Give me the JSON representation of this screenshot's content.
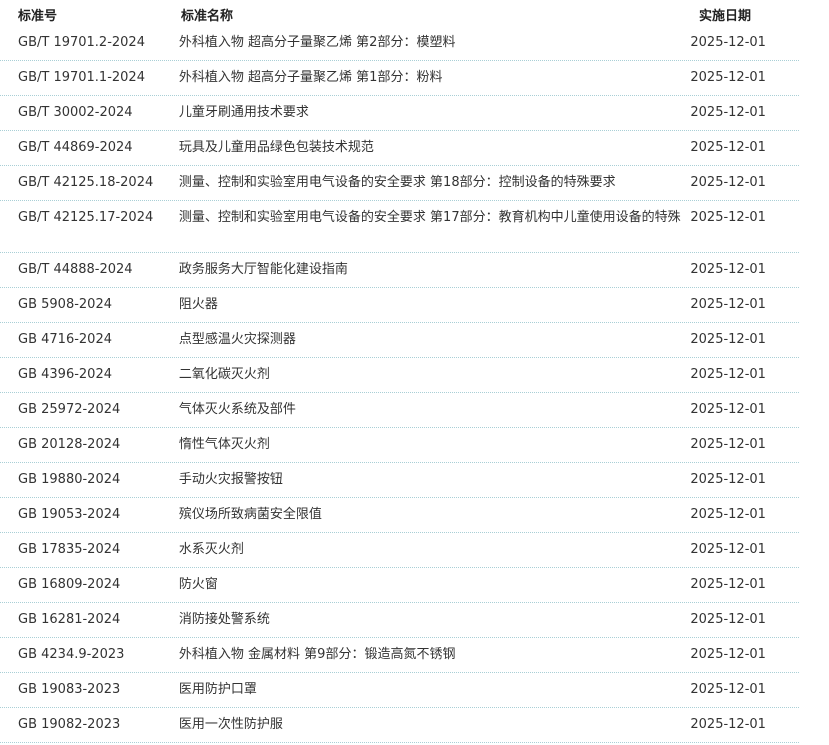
{
  "table": {
    "headers": {
      "code": "标准号",
      "name": "标准名称",
      "date": "实施日期"
    },
    "rows": [
      {
        "code": "GB/T 19701.2-2024",
        "name": "外科植入物 超高分子量聚乙烯 第2部分：模塑料",
        "date": "2025-12-01"
      },
      {
        "code": "GB/T 19701.1-2024",
        "name": "外科植入物 超高分子量聚乙烯 第1部分：粉料",
        "date": "2025-12-01"
      },
      {
        "code": "GB/T 30002-2024",
        "name": "儿童牙刷通用技术要求",
        "date": "2025-12-01"
      },
      {
        "code": "GB/T 44869-2024",
        "name": "玩具及儿童用品绿色包装技术规范",
        "date": "2025-12-01"
      },
      {
        "code": "GB/T 42125.18-2024",
        "name": "测量、控制和实验室用电气设备的安全要求 第18部分：控制设备的特殊要求",
        "date": "2025-12-01"
      },
      {
        "code": "GB/T 42125.17-2024",
        "name": "测量、控制和实验室用电气设备的安全要求 第17部分：教育机构中儿童使用设备的特殊",
        "date": "2025-12-01"
      },
      {
        "code": "GB/T 44888-2024",
        "name": "政务服务大厅智能化建设指南",
        "date": "2025-12-01"
      },
      {
        "code": "GB 5908-2024",
        "name": "阻火器",
        "date": "2025-12-01"
      },
      {
        "code": "GB 4716-2024",
        "name": "点型感温火灾探测器",
        "date": "2025-12-01"
      },
      {
        "code": "GB 4396-2024",
        "name": "二氧化碳灭火剂",
        "date": "2025-12-01"
      },
      {
        "code": "GB 25972-2024",
        "name": "气体灭火系统及部件",
        "date": "2025-12-01"
      },
      {
        "code": "GB 20128-2024",
        "name": "惰性气体灭火剂",
        "date": "2025-12-01"
      },
      {
        "code": "GB 19880-2024",
        "name": "手动火灾报警按钮",
        "date": "2025-12-01"
      },
      {
        "code": "GB 19053-2024",
        "name": "殡仪场所致病菌安全限值",
        "date": "2025-12-01"
      },
      {
        "code": "GB 17835-2024",
        "name": "水系灭火剂",
        "date": "2025-12-01"
      },
      {
        "code": "GB 16809-2024",
        "name": "防火窗",
        "date": "2025-12-01"
      },
      {
        "code": "GB 16281-2024",
        "name": "消防接处警系统",
        "date": "2025-12-01"
      },
      {
        "code": "GB 4234.9-2023",
        "name": "外科植入物 金属材料 第9部分：锻造高氮不锈钢",
        "date": "2025-12-01"
      },
      {
        "code": "GB 19083-2023",
        "name": "医用防护口罩",
        "date": "2025-12-01"
      },
      {
        "code": "GB 19082-2023",
        "name": "医用一次性防护服",
        "date": "2025-12-01"
      }
    ]
  }
}
